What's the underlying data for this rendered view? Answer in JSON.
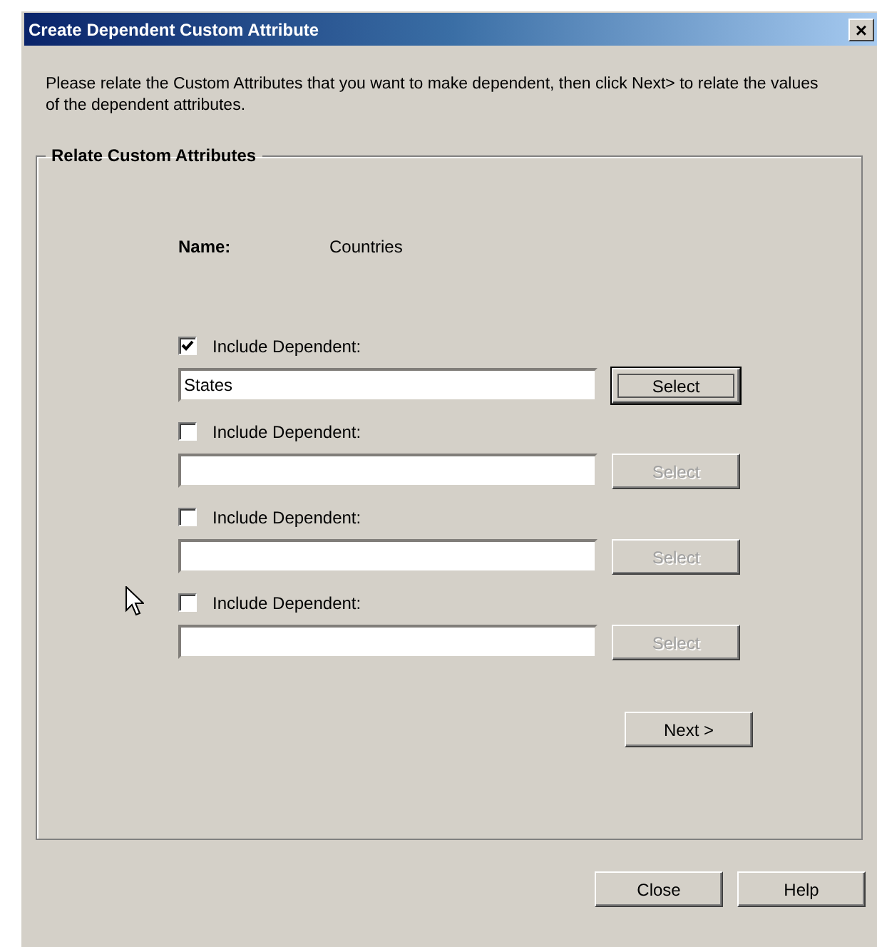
{
  "window": {
    "title": "Create Dependent Custom Attribute",
    "close_glyph": "×"
  },
  "intro": "Please relate the Custom Attributes that you want to make dependent, then click Next> to relate the values of the dependent attributes.",
  "group": {
    "title": "Relate Custom Attributes",
    "name_label": "Name:",
    "name_value": "Countries",
    "dependents": [
      {
        "label": "Include Dependent:",
        "checked": true,
        "value": "States",
        "button": "Select",
        "disabled": false,
        "focused": true
      },
      {
        "label": "Include Dependent:",
        "checked": false,
        "button": "Select",
        "disabled": true,
        "focused": false
      },
      {
        "label": "Include Dependent:",
        "checked": false,
        "button": "Select",
        "disabled": true,
        "focused": false
      },
      {
        "label": "Include Dependent:",
        "checked": false,
        "button": "Select",
        "disabled": true,
        "focused": false
      }
    ],
    "next_button": "Next >"
  },
  "buttons": [
    "Close",
    "Help"
  ]
}
